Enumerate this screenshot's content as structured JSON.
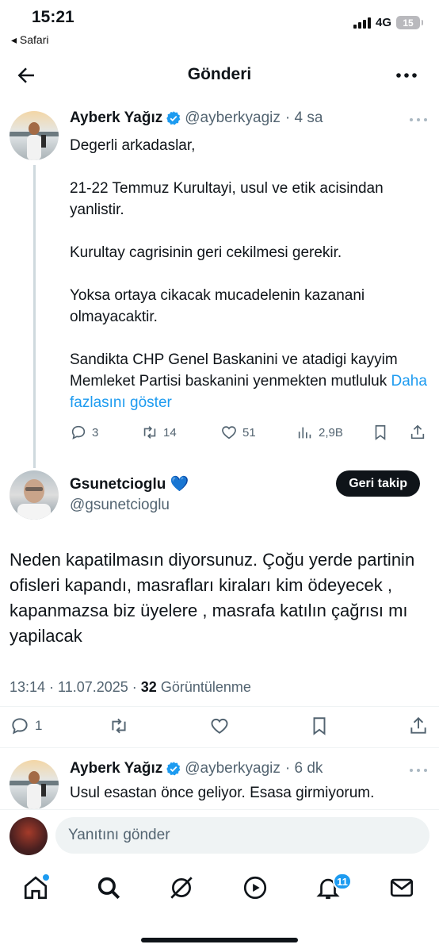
{
  "status_bar": {
    "time": "15:21",
    "back_app": "◂ Safari",
    "network": "4G",
    "battery": "15"
  },
  "header": {
    "title": "Gönderi"
  },
  "parent_tweet": {
    "name": "Ayberk Yağız",
    "handle": "@ayberkyagiz",
    "time": "· 4 sa",
    "text": "Degerli arkadaslar,\n\n21-22 Temmuz Kurultayi, usul ve etik acisindan yanlistir.\n\nKurultay cagrisinin geri cekilmesi gerekir.\n\nYoksa ortaya cikacak mucadelenin kazanani olmayacaktir.\n\nSandikta CHP Genel Baskanini ve atadigi kayyim Memleket Partisi baskanini yenmekten mutluluk ",
    "show_more": "Daha fazlasını göster",
    "replies": "3",
    "retweets": "14",
    "likes": "51",
    "views": "2,9B"
  },
  "main_tweet": {
    "name": "Gsunetcioglu 💙",
    "handle": "@gsunetcioglu",
    "follow_back_label": "Geri takip",
    "text": "Neden kapatilmasın diyorsunuz. Çoğu yerde partinin ofisleri kapandı, masrafları kiraları kim ödeyecek , kapanmazsa biz üyelere ,  masrafa katılın çağrısı mı yapilacak",
    "timestamp": "13:14 · 11.07.2025 · ",
    "view_count": "32",
    "view_label": " Görüntülenme",
    "replies": "1"
  },
  "reply_tweet": {
    "name": "Ayberk Yağız",
    "handle": "@ayberkyagiz",
    "time": "· 6 dk",
    "text": "Usul esastan önce geliyor. Esasa girmiyorum."
  },
  "reply_bar": {
    "placeholder": "Yanıtını gönder"
  },
  "tab_bar": {
    "items": [
      "home-icon",
      "search-icon",
      "grok-icon",
      "video-icon",
      "notifications-icon",
      "messages-icon"
    ],
    "notification_badge": "11"
  },
  "colors": {
    "accent": "#1d9bf0",
    "text": "#0f1419",
    "secondary": "#536471"
  }
}
